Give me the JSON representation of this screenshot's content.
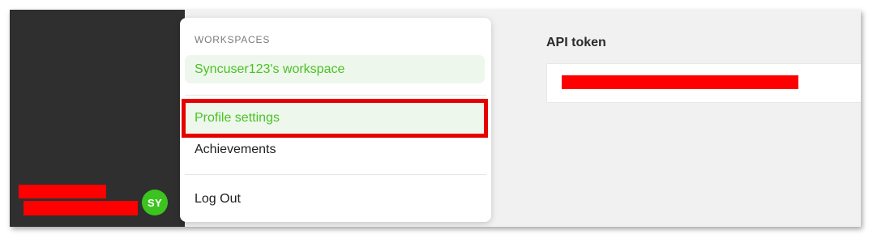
{
  "sidebar": {
    "avatar_initials": "SY",
    "avatar_color": "#3cc31f"
  },
  "menu": {
    "heading": "WORKSPACES",
    "workspace_item": "Syncuser123's workspace",
    "items": [
      {
        "label": "Profile settings",
        "state": "highlighted"
      },
      {
        "label": "Achievements"
      },
      {
        "label": "Log Out"
      }
    ]
  },
  "main": {
    "api_token_label": "API token"
  },
  "colors": {
    "accent_green": "#49c225",
    "selected_background": "#eef7ec",
    "highlight_outline": "#e60000",
    "redaction": "#ff0000",
    "sidebar_background": "#2f2f2f"
  }
}
